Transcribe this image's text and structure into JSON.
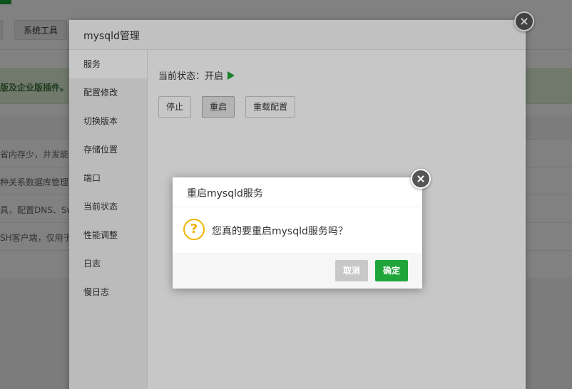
{
  "background": {
    "tab_label": "系统工具",
    "banner_text": "版及企业版插件。",
    "rows": [
      "省内存少，并发能力",
      "种关系数据库管理系",
      "具，配置DNS、Sw",
      "SH客户端，仅用于"
    ]
  },
  "panel": {
    "title": "mysqld管理",
    "sidebar": [
      {
        "label": "服务",
        "active": true
      },
      {
        "label": "配置修改"
      },
      {
        "label": "切换版本"
      },
      {
        "label": "存储位置"
      },
      {
        "label": "端口"
      },
      {
        "label": "当前状态"
      },
      {
        "label": "性能调整"
      },
      {
        "label": "日志"
      },
      {
        "label": "慢日志"
      }
    ],
    "status_label": "当前状态：",
    "status_value": "开启",
    "buttons": {
      "stop": "停止",
      "restart": "重启",
      "reload": "重载配置"
    }
  },
  "dialog": {
    "title": "重启mysqld服务",
    "icon": "question-icon",
    "icon_glyph": "?",
    "message": "您真的要重启mysqld服务吗？",
    "cancel_label": "取消",
    "confirm_label": "确定"
  },
  "colors": {
    "accent_green": "#20a53a",
    "warning_yellow": "#f0b400",
    "close_dark": "#555555"
  }
}
